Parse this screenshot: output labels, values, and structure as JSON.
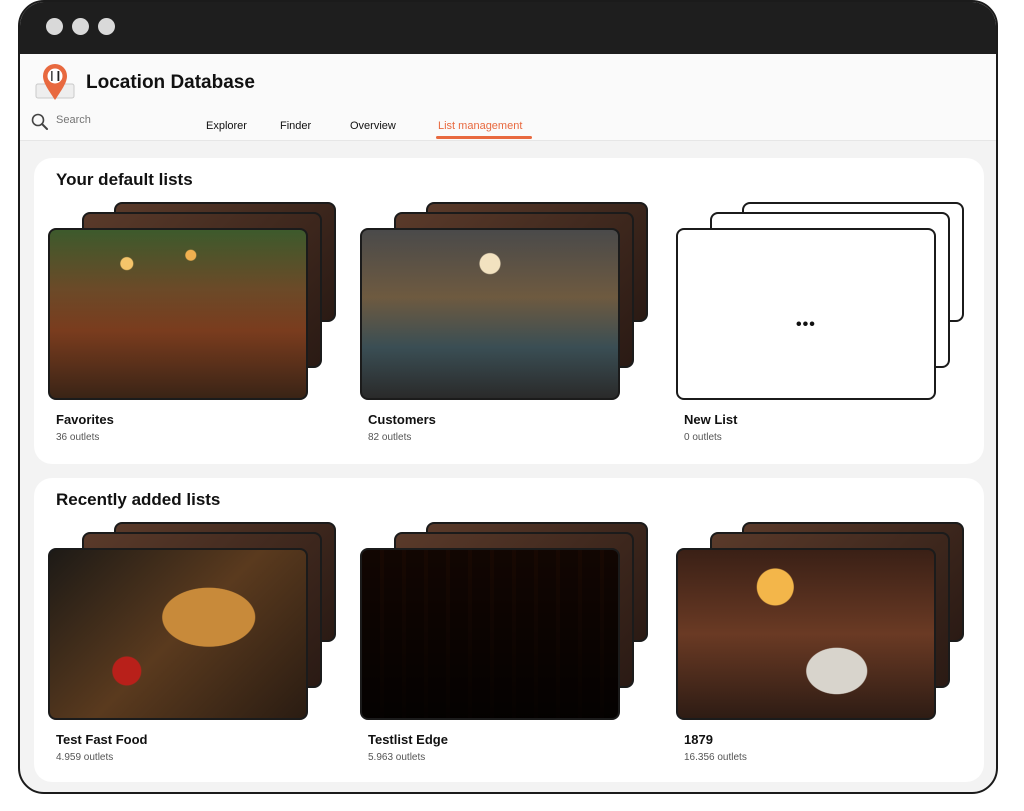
{
  "window": {
    "controls": [
      "close",
      "minimize",
      "maximize"
    ]
  },
  "header": {
    "app_title": "Location Database",
    "logo_icon": "location-pin-cutlery-icon",
    "search": {
      "placeholder": "Search",
      "icon": "magnifier-icon"
    },
    "nav": [
      {
        "label": "Explorer",
        "active": false
      },
      {
        "label": "Finder",
        "active": false
      },
      {
        "label": "Overview",
        "active": false
      },
      {
        "label": "List management",
        "active": true
      }
    ],
    "accent_color": "#e8693f"
  },
  "sections": [
    {
      "title": "Your default lists",
      "lists": [
        {
          "name": "Favorites",
          "count": "36 outlets",
          "image": "restaurant-interior-green-ceiling"
        },
        {
          "name": "Customers",
          "count": "82 outlets",
          "image": "industrial-restaurant-interior"
        },
        {
          "name": "New List",
          "count": "0 outlets",
          "image": "empty",
          "more_label": "•••"
        }
      ]
    },
    {
      "title": "Recently added lists",
      "lists": [
        {
          "name": "Test Fast Food",
          "count": "4.959 outlets",
          "image": "burger-and-fries"
        },
        {
          "name": "Testlist Edge",
          "count": "5.963 outlets",
          "image": "busy-bar-night"
        },
        {
          "name": "1879",
          "count": "16.356 outlets",
          "image": "fine-dining-table-lamp"
        }
      ]
    }
  ]
}
